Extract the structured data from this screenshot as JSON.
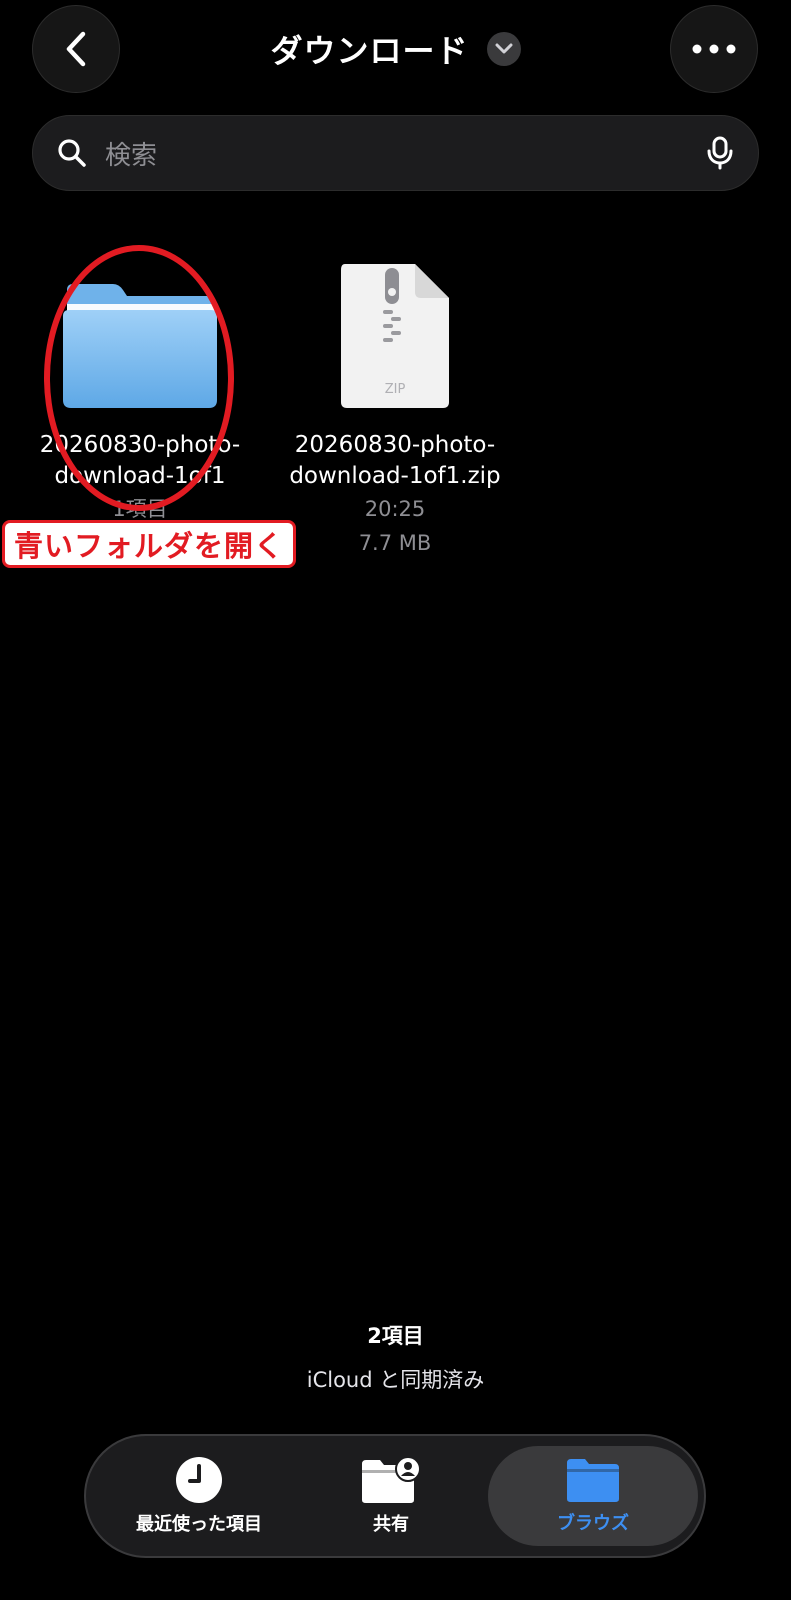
{
  "header": {
    "title": "ダウンロード",
    "back_icon": "chevron-left-icon",
    "more_icon": "ellipsis-icon"
  },
  "search": {
    "placeholder": "検索"
  },
  "items": [
    {
      "name_line1": "20260830-photo-",
      "name_line2": "download-1of1",
      "meta1": "1項目",
      "icon": "folder-icon",
      "color": "#7fbdf0"
    },
    {
      "name_line1": "20260830-photo-",
      "name_line2": "download-1of1.zip",
      "meta1": "20:25",
      "meta2": "7.7 MB",
      "icon": "zip-file-icon",
      "badge": "ZIP"
    }
  ],
  "annotation": {
    "callout_text": "青いフォルダを開く",
    "color": "#e21b22"
  },
  "footer": {
    "count": "2項目",
    "sync": "iCloud と同期済み"
  },
  "tabs": [
    {
      "label": "最近使った項目",
      "icon": "clock-icon"
    },
    {
      "label": "共有",
      "icon": "shared-folder-icon"
    },
    {
      "label": "ブラウズ",
      "icon": "folder-icon",
      "selected": true,
      "color": "#3d8ff2"
    }
  ]
}
